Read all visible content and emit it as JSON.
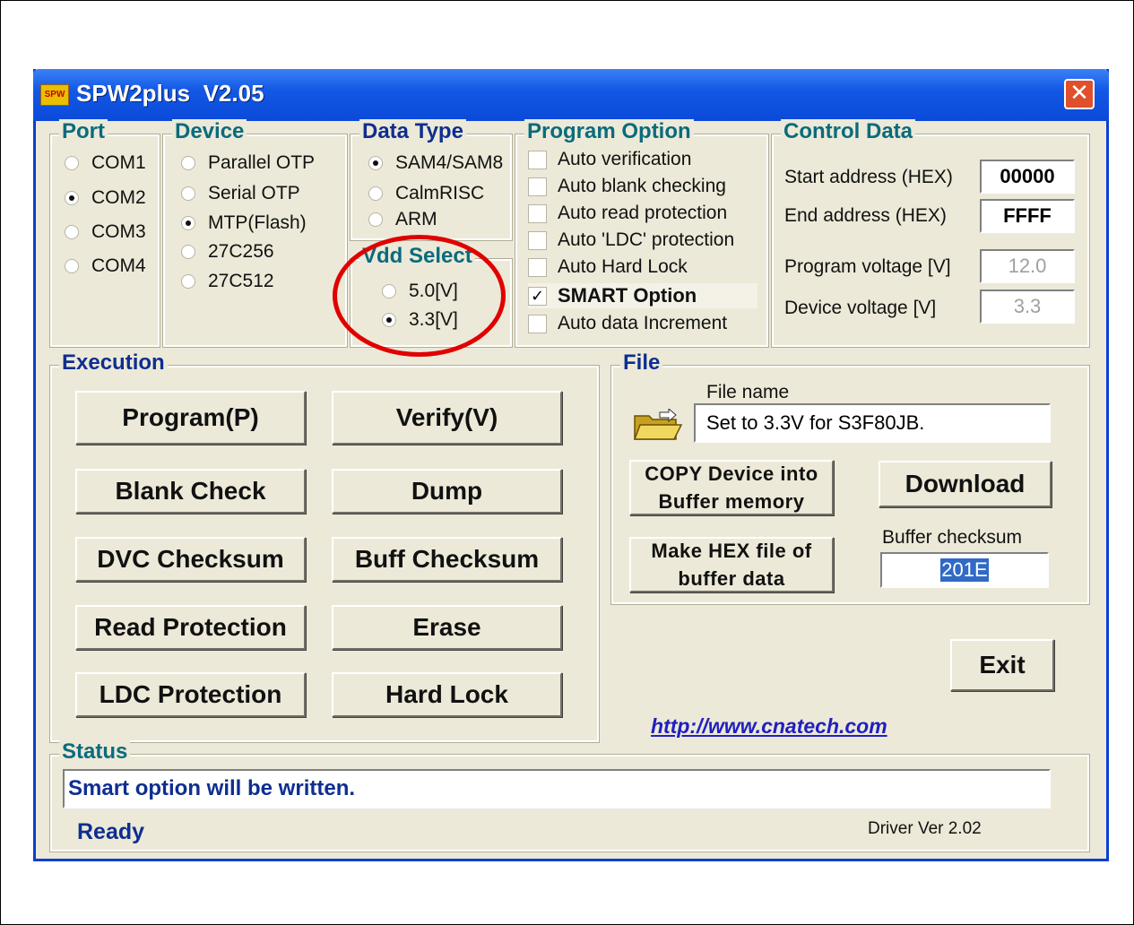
{
  "window": {
    "title": "SPW2plus  V2.05",
    "close_glyph": "✕"
  },
  "port": {
    "legend": "Port",
    "options": [
      "COM1",
      "COM2",
      "COM3",
      "COM4"
    ],
    "selected": "COM2"
  },
  "device": {
    "legend": "Device",
    "options": [
      "Parallel OTP",
      "Serial OTP",
      "MTP(Flash)",
      "27C256",
      "27C512"
    ],
    "selected": "MTP(Flash)"
  },
  "data_type": {
    "legend": "Data Type",
    "options": [
      "SAM4/SAM8",
      "CalmRISC",
      "ARM"
    ],
    "selected": "SAM4/SAM8"
  },
  "vdd": {
    "legend": "Vdd Select",
    "options": [
      "5.0[V]",
      "3.3[V]"
    ],
    "selected": "3.3[V]"
  },
  "program_option": {
    "legend": "Program Option",
    "items": [
      {
        "label": "Auto verification",
        "checked": false
      },
      {
        "label": "Auto blank checking",
        "checked": false
      },
      {
        "label": "Auto read protection",
        "checked": false
      },
      {
        "label": "Auto 'LDC' protection",
        "checked": false
      },
      {
        "label": "Auto Hard Lock",
        "checked": false
      },
      {
        "label": "SMART Option",
        "checked": true
      },
      {
        "label": "Auto data Increment",
        "checked": false
      }
    ]
  },
  "control": {
    "legend": "Control Data",
    "start_label": "Start address (HEX)",
    "start_value": "00000",
    "end_label": "End address (HEX)",
    "end_value": "FFFF",
    "prog_v_label": "Program voltage [V]",
    "prog_v_value": "12.0",
    "dev_v_label": "Device voltage [V]",
    "dev_v_value": "3.3"
  },
  "execution": {
    "legend": "Execution",
    "buttons": [
      "Program(P)",
      "Verify(V)",
      "Blank Check",
      "Dump",
      "DVC Checksum",
      "Buff Checksum",
      "Read Protection",
      "Erase",
      "LDC Protection",
      "Hard Lock"
    ]
  },
  "file": {
    "legend": "File",
    "name_label": "File name",
    "name_value": "Set to 3.3V for S3F80JB.",
    "copy_line1": "COPY Device into",
    "copy_line2": "Buffer memory",
    "hex_line1": "Make HEX file of",
    "hex_line2": "buffer data",
    "download_label": "Download",
    "checksum_label": "Buffer checksum",
    "checksum_value": "201E",
    "exit_label": "Exit",
    "link": "http://www.cnatech.com"
  },
  "status": {
    "legend": "Status",
    "message": "Smart option will be written.",
    "state": "Ready",
    "driver": "Driver Ver 2.02"
  },
  "colors": {
    "annotation": "#e00000",
    "title_bar": "#0b4ad8",
    "legend_text": "#0a6b7d"
  }
}
